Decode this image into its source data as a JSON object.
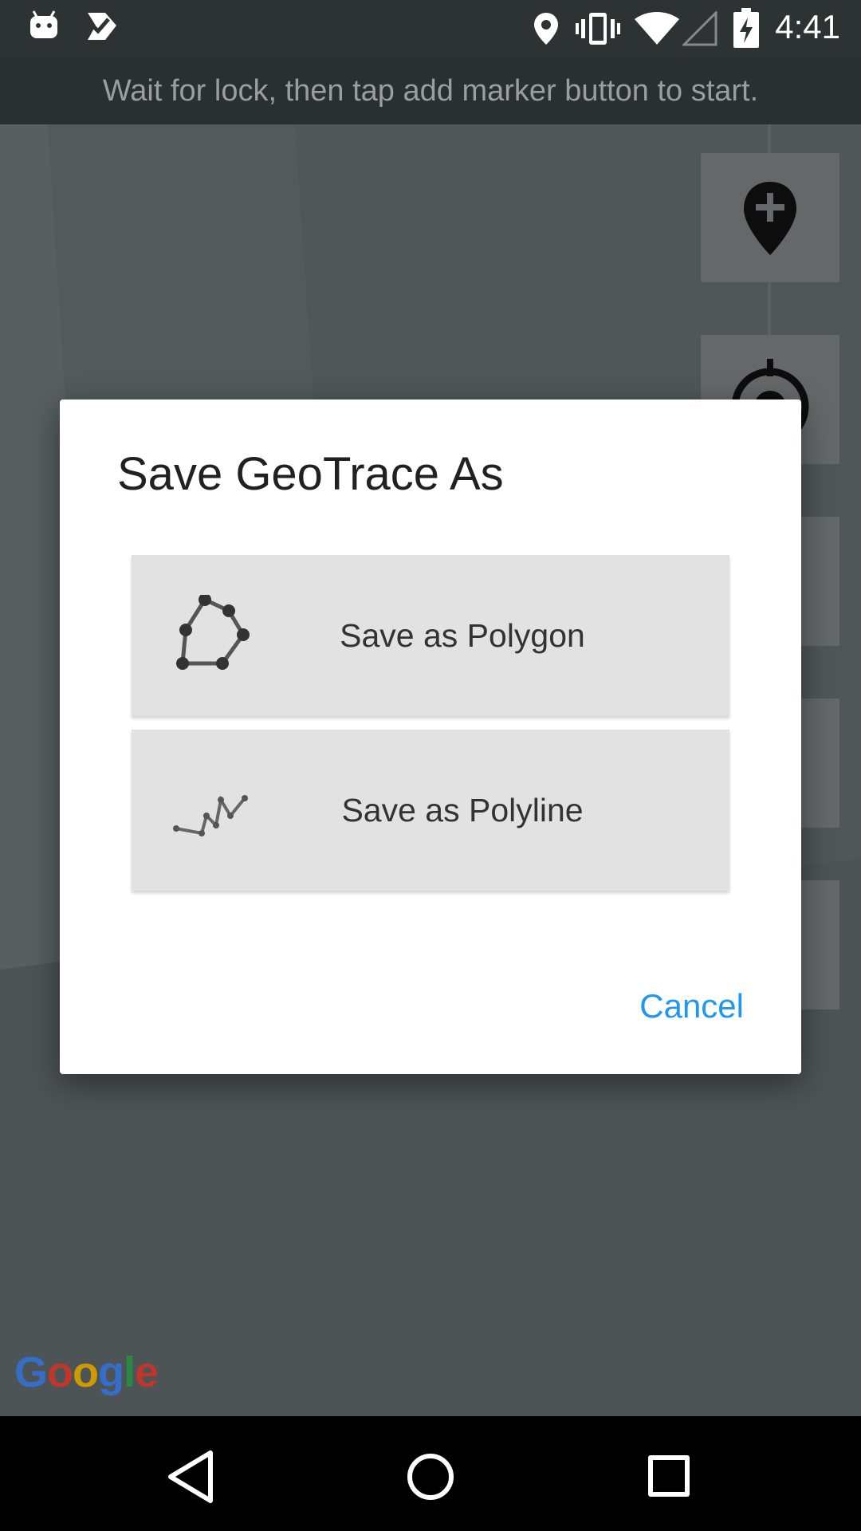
{
  "status_bar": {
    "time": "4:41",
    "icons": [
      "android-icon",
      "checkmark-app-icon",
      "location-pin-icon",
      "vibrate-icon",
      "wifi-icon",
      "signal-icon",
      "battery-icon"
    ]
  },
  "banner": {
    "text": "Wait for lock, then tap add marker button to start."
  },
  "map": {
    "buttons": [
      "add-marker-icon",
      "gps-lock-icon"
    ],
    "attribution": "Google"
  },
  "dialog": {
    "title": "Save GeoTrace As",
    "options": [
      {
        "label": "Save as Polygon",
        "icon": "polygon-icon"
      },
      {
        "label": "Save as Polyline",
        "icon": "polyline-icon"
      }
    ],
    "cancel_label": "Cancel",
    "accent_color": "#2196f3"
  },
  "nav_bar": {
    "buttons": [
      "back-icon",
      "home-icon",
      "recents-icon"
    ]
  }
}
